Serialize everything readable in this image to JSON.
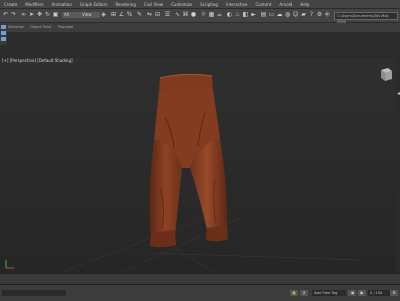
{
  "menu": {
    "items": [
      "Create",
      "Modifiers",
      "Animation",
      "Graph Editors",
      "Rendering",
      "Civil View",
      "Customize",
      "Scripting",
      "Interactive",
      "Content",
      "Arnold",
      "Help"
    ]
  },
  "toolbar": {
    "selection_filter": "All",
    "view_dropdown": "View",
    "search_placeholder": "C:\\Users\\Documents\\3ds Max 2020"
  },
  "ribbon": {
    "tabs": [
      "Selection",
      "Object Paint",
      "Populate"
    ]
  },
  "viewport": {
    "label": "[+] [Perspective] [Default Shading]"
  },
  "status": {
    "add_time_tag": "Add Time Tag",
    "frame": "0 / 100"
  },
  "colors": {
    "pants": "#8a3d22",
    "pants_shadow": "#5e2814",
    "pants_highlight": "#a44e2c",
    "accent": "#6fa0d8"
  }
}
